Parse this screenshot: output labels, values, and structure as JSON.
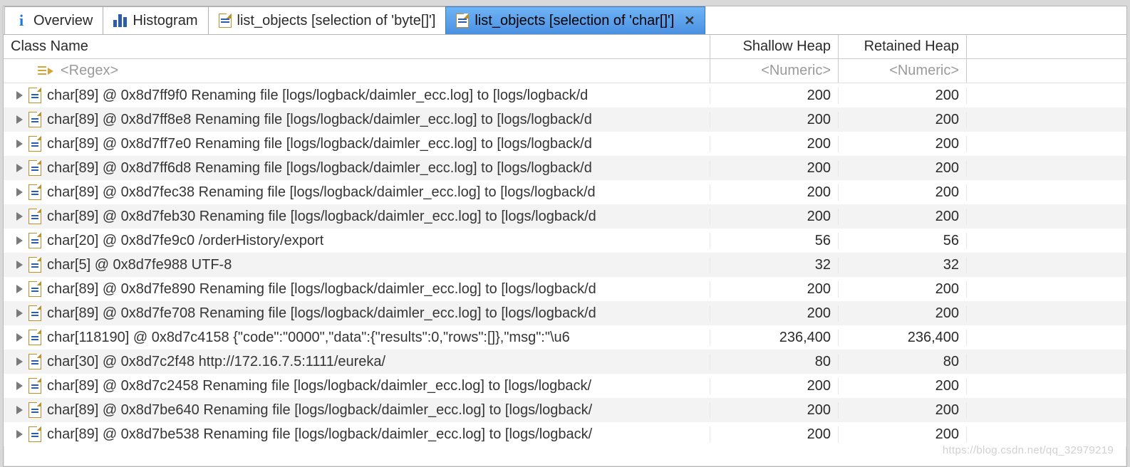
{
  "tabs": [
    {
      "label": "Overview",
      "icon": "info"
    },
    {
      "label": "Histogram",
      "icon": "histogram"
    },
    {
      "label": "list_objects  [selection of 'byte[]']",
      "icon": "sheet"
    },
    {
      "label": "list_objects  [selection of 'char[]']",
      "icon": "sheet",
      "active": true,
      "closeable": true
    }
  ],
  "columns": {
    "name": "Class Name",
    "shallow": "Shallow Heap",
    "retained": "Retained Heap"
  },
  "filter": {
    "name_placeholder": "<Regex>",
    "shallow_placeholder": "<Numeric>",
    "retained_placeholder": "<Numeric>"
  },
  "rows": [
    {
      "name": "char[89] @ 0x8d7ff9f0  Renaming file [logs/logback/daimler_ecc.log] to [logs/logback/d",
      "shallow": "200",
      "retained": "200"
    },
    {
      "name": "char[89] @ 0x8d7ff8e8  Renaming file [logs/logback/daimler_ecc.log] to [logs/logback/d",
      "shallow": "200",
      "retained": "200"
    },
    {
      "name": "char[89] @ 0x8d7ff7e0  Renaming file [logs/logback/daimler_ecc.log] to [logs/logback/d",
      "shallow": "200",
      "retained": "200"
    },
    {
      "name": "char[89] @ 0x8d7ff6d8  Renaming file [logs/logback/daimler_ecc.log] to [logs/logback/d",
      "shallow": "200",
      "retained": "200"
    },
    {
      "name": "char[89] @ 0x8d7fec38  Renaming file [logs/logback/daimler_ecc.log] to [logs/logback/d",
      "shallow": "200",
      "retained": "200"
    },
    {
      "name": "char[89] @ 0x8d7feb30  Renaming file [logs/logback/daimler_ecc.log] to [logs/logback/d",
      "shallow": "200",
      "retained": "200"
    },
    {
      "name": "char[20] @ 0x8d7fe9c0  /orderHistory/export",
      "shallow": "56",
      "retained": "56"
    },
    {
      "name": "char[5] @ 0x8d7fe988  UTF-8",
      "shallow": "32",
      "retained": "32"
    },
    {
      "name": "char[89] @ 0x8d7fe890  Renaming file [logs/logback/daimler_ecc.log] to [logs/logback/d",
      "shallow": "200",
      "retained": "200"
    },
    {
      "name": "char[89] @ 0x8d7fe708  Renaming file [logs/logback/daimler_ecc.log] to [logs/logback/d",
      "shallow": "200",
      "retained": "200"
    },
    {
      "name": "char[118190] @ 0x8d7c4158  {\"code\":\"0000\",\"data\":{\"results\":0,\"rows\":[]},\"msg\":\"\\u6",
      "shallow": "236,400",
      "retained": "236,400"
    },
    {
      "name": "char[30] @ 0x8d7c2f48  http://172.16.7.5:1111/eureka/",
      "shallow": "80",
      "retained": "80"
    },
    {
      "name": "char[89] @ 0x8d7c2458  Renaming file [logs/logback/daimler_ecc.log] to [logs/logback/",
      "shallow": "200",
      "retained": "200"
    },
    {
      "name": "char[89] @ 0x8d7be640  Renaming file [logs/logback/daimler_ecc.log] to [logs/logback/",
      "shallow": "200",
      "retained": "200"
    },
    {
      "name": "char[89] @ 0x8d7be538  Renaming file [logs/logback/daimler_ecc.log] to [logs/logback/",
      "shallow": "200",
      "retained": "200"
    }
  ],
  "watermark": "https://blog.csdn.net/qq_32979219"
}
